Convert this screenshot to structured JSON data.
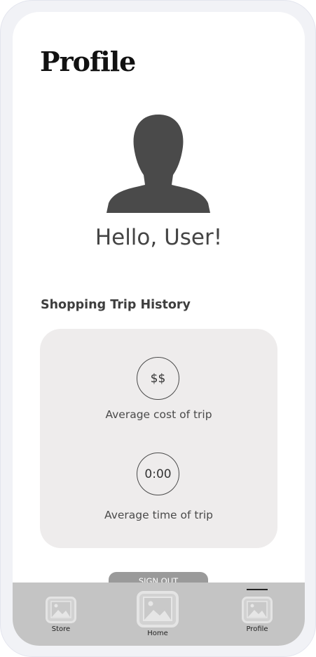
{
  "header": {
    "title": "Profile"
  },
  "profile": {
    "avatar_icon": "person-silhouette-icon",
    "greeting": "Hello, User!"
  },
  "history": {
    "heading": "Shopping Trip History",
    "stats": [
      {
        "icon_text": "$$",
        "label": "Average cost of trip"
      },
      {
        "icon_text": "0:00",
        "label": "Average time of trip"
      }
    ]
  },
  "actions": {
    "sign_out_label": "SIGN OUT"
  },
  "tab_bar": {
    "active_tab": "Profile",
    "items": [
      {
        "label": "Store",
        "icon": "image-placeholder-icon"
      },
      {
        "label": "Home",
        "icon": "image-placeholder-icon"
      },
      {
        "label": "Profile",
        "icon": "image-placeholder-icon"
      }
    ]
  },
  "colors": {
    "avatar": "#4a4a4a",
    "card_background": "#eeecec",
    "tab_bar_background": "#c4c4c4",
    "sign_out_button": "#9a9a9a"
  }
}
